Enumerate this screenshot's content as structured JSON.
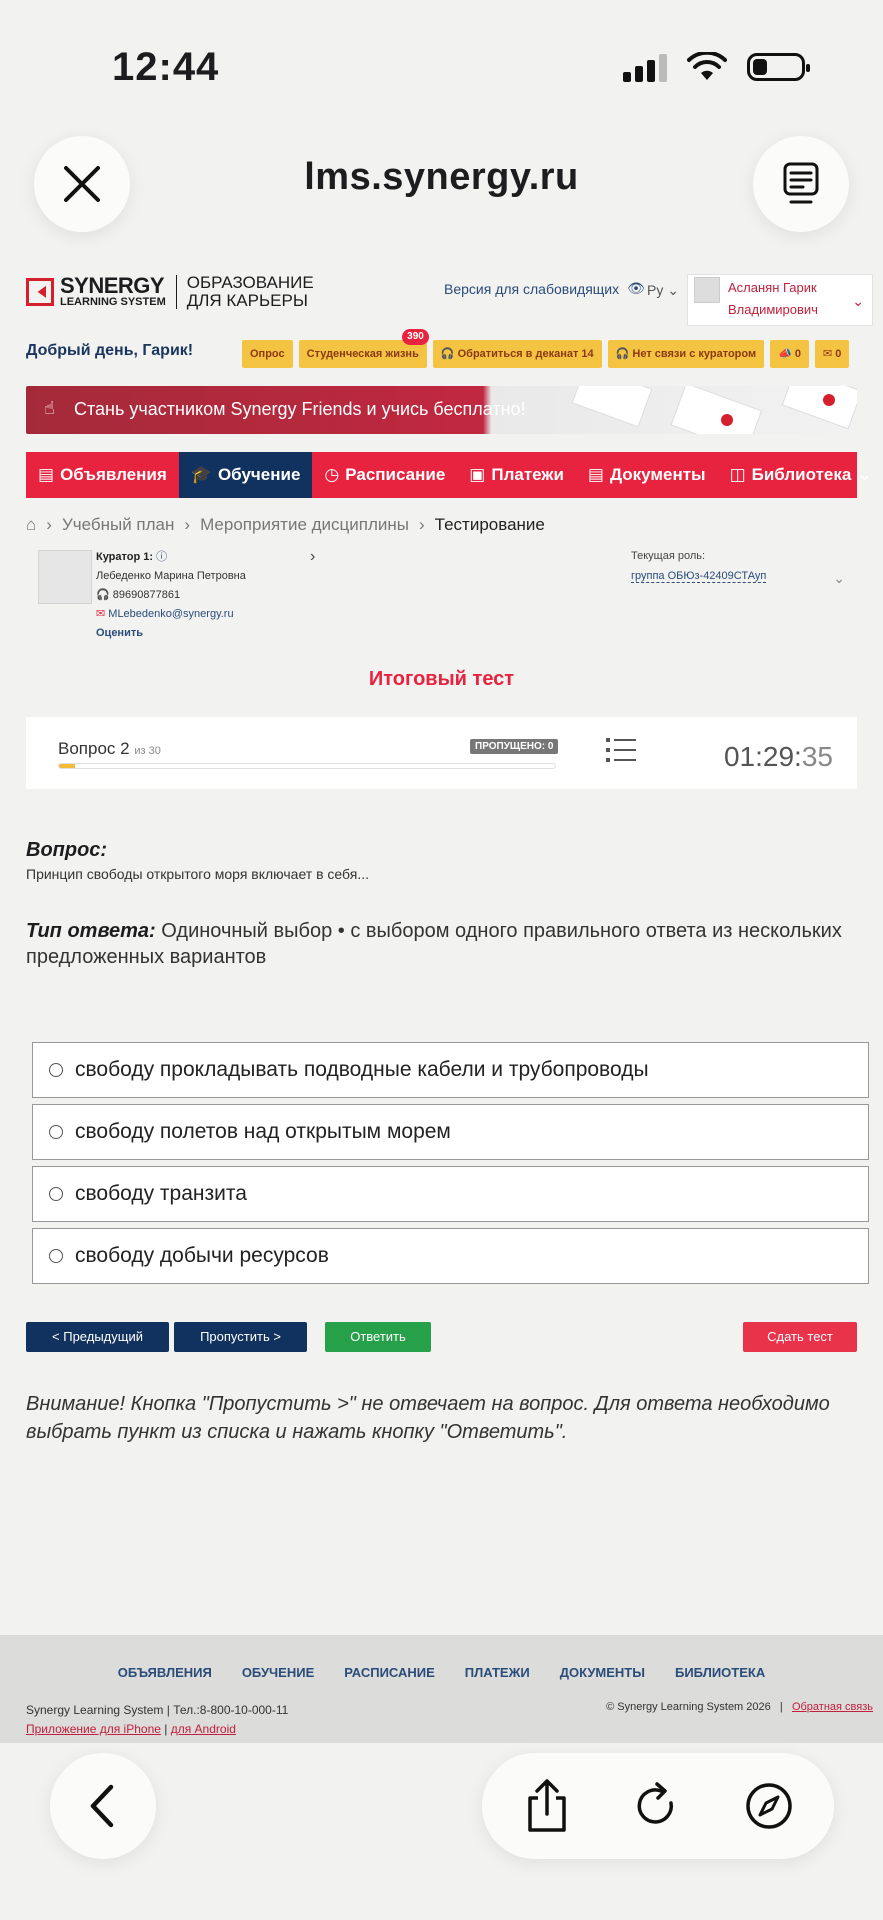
{
  "status": {
    "time": "12:44"
  },
  "browser": {
    "url": "lms.synergy.ru"
  },
  "logo": {
    "brand": "SYNERGY",
    "brand_sub": "LEARNING SYSTEM",
    "line1": "ОБРАЗОВАНИЕ",
    "line2": "ДЛЯ КАРЬЕРЫ"
  },
  "header": {
    "vision": "Версия для слабовидящих",
    "lang": "Ру",
    "user_first": "Асланян Гарик",
    "user_second": "Владимирович"
  },
  "greeting": "Добрый день, Гарик!",
  "pills": [
    {
      "label": "Опрос"
    },
    {
      "label": "Студенческая жизнь",
      "badge": "390"
    },
    {
      "label": "Обратиться в деканат 14"
    },
    {
      "label": "Нет связи с куратором"
    },
    {
      "label": "0"
    },
    {
      "label": "0"
    }
  ],
  "banner": {
    "text": "Стань участником Synergy Friends и учись бесплатно!"
  },
  "nav": [
    {
      "label": "Объявления"
    },
    {
      "label": "Обучение"
    },
    {
      "label": "Расписание"
    },
    {
      "label": "Платежи"
    },
    {
      "label": "Документы"
    },
    {
      "label": "Библиотека"
    }
  ],
  "breadcrumb": [
    "Учебный план",
    "Мероприятие дисциплины",
    "Тестирование"
  ],
  "curator": {
    "title": "Куратор 1:",
    "name": "Лебеденко Марина Петровна",
    "phone": "89690877861",
    "email": "MLebedenko@synergy.ru",
    "rate": "Оценить",
    "role_label": "Текущая роль:",
    "role_value": "группа ОБЮз-42409СТАуп"
  },
  "test": {
    "title": "Итоговый тест",
    "question_label": "Вопрос 2",
    "question_of": "из 30",
    "skipped": "ПРОПУЩЕНО: 0",
    "progress": 0.033,
    "timer_main": "01:29:",
    "timer_sec": "35",
    "q_head": "Вопрос:",
    "q_text": "Принцип свободы открытого моря включает в себя...",
    "answer_type_label": "Тип ответа:",
    "answer_type_value": "Одиночный выбор • с выбором одного правильного ответа из нескольких предложенных вариантов",
    "options": [
      "свободу прокладывать подводные кабели и трубопроводы",
      "свободу полетов над открытым морем",
      "свободу транзита",
      "свободу добычи ресурсов"
    ],
    "btn_prev": "< Предыдущий",
    "btn_skip": "Пропустить >",
    "btn_answer": "Ответить",
    "btn_submit": "Сдать тест",
    "notice": "Внимание! Кнопка \"Пропустить >\" не отвечает на вопрос. Для ответа необходимо выбрать пункт из списка и нажать кнопку \"Ответить\"."
  },
  "footer": {
    "nav": [
      "ОБЪЯВЛЕНИЯ",
      "ОБУЧЕНИЕ",
      "РАСПИСАНИЕ",
      "ПЛАТЕЖИ",
      "ДОКУМЕНТЫ",
      "БИБЛИОТЕКА"
    ],
    "company": "Synergy Learning System",
    "phone": "Тел.:8-800-10-000-11",
    "iphone": "Приложение для iPhone",
    "android": "для Android",
    "copyright": "© Synergy Learning System 2026",
    "feedback": "Обратная связь"
  },
  "colors": {
    "accent": "#e8233f",
    "navy": "#11315f",
    "green": "#27a04a",
    "pill": "#f5c342"
  }
}
